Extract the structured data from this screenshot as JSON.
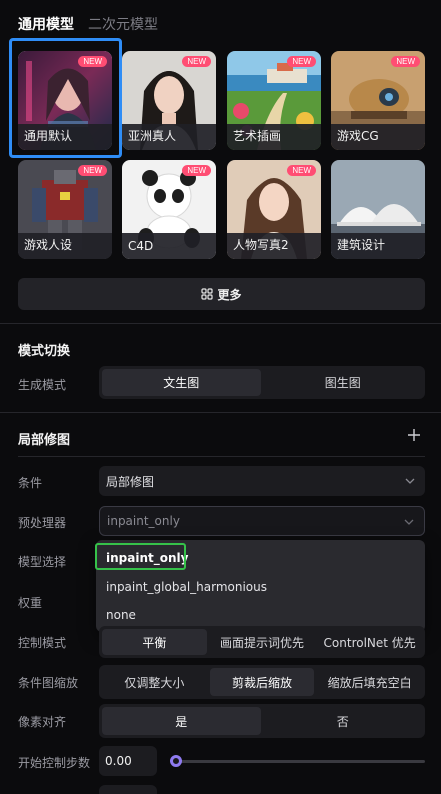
{
  "tabs": [
    "通用模型",
    "二次元模型"
  ],
  "models": [
    {
      "label": "通用默认",
      "new": "NEW",
      "selected": true
    },
    {
      "label": "亚洲真人",
      "new": "NEW"
    },
    {
      "label": "艺术插画",
      "new": "NEW"
    },
    {
      "label": "游戏CG",
      "new": "NEW"
    },
    {
      "label": "游戏人设",
      "new": "NEW"
    },
    {
      "label": "C4D",
      "new": "NEW"
    },
    {
      "label": "人物写真2",
      "new": "NEW"
    },
    {
      "label": "建筑设计",
      "new": ""
    }
  ],
  "more_button": "更多",
  "mode_section": {
    "title": "模式切换",
    "gen_mode_label": "生成模式",
    "options": [
      "文生图",
      "图生图"
    ],
    "selected": "文生图"
  },
  "inpaint_section": {
    "title": "局部修图",
    "condition_label": "条件",
    "condition_value": "局部修图",
    "preprocessor_label": "预处理器",
    "preprocessor_value": "inpaint_only",
    "model_label": "模型选择",
    "weight_label": "权重",
    "control_mode_label": "控制模式",
    "control_mode_options": [
      "平衡",
      "画面提示词优先",
      "ControlNet 优先"
    ],
    "control_mode_selected": "平衡",
    "resize_label": "条件图缩放",
    "resize_options": [
      "仅调整大小",
      "剪裁后缩放",
      "缩放后填充空白"
    ],
    "resize_selected": "剪裁后缩放",
    "pixel_align_label": "像素对齐",
    "pixel_align_options": [
      "是",
      "否"
    ],
    "pixel_align_selected": "是",
    "start_step_label": "开始控制步数",
    "start_step_value": "0.00",
    "start_step_fraction": 0.0
  },
  "dropdown_options": [
    "inpaint_only",
    "inpaint_global_harmonious",
    "none"
  ],
  "dropdown_active": "inpaint_only",
  "colors": {
    "accent_blue": "#2f8df6",
    "highlight_green": "#36c24a",
    "new_badge": "#ff4d73",
    "slider_thumb": "#8f7bf0"
  }
}
